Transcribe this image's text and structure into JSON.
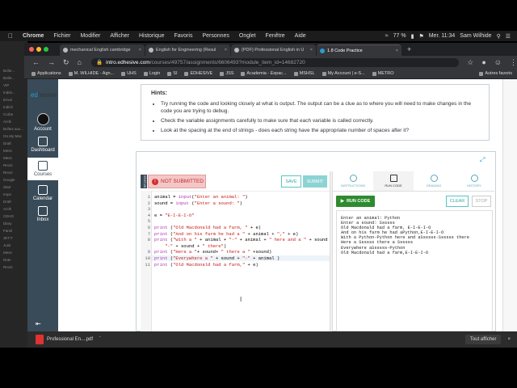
{
  "menubar": {
    "apple": "",
    "items": [
      "Chrome",
      "Fichier",
      "Modifier",
      "Afficher",
      "Historique",
      "Favoris",
      "Personnes",
      "Onglet",
      "Fenêtre",
      "Aide"
    ],
    "battery": "77 %",
    "clock": "Mer. 11:34",
    "user": "Sam Wilhide"
  },
  "tabs": [
    {
      "label": "mechanical English cambridge"
    },
    {
      "label": "English for Engineering (Resul"
    },
    {
      "label": "(PDF) Professional English in U"
    },
    {
      "label": "1.8 Code Practice"
    }
  ],
  "address": {
    "host": "intro.edhesive.com",
    "path": "/courses/49757/assignments/6606493?module_item_id=14682720"
  },
  "bookmarks": [
    "Applications",
    "M. WILHIDE - Agn...",
    "UHS",
    "Login",
    "SI",
    "EDHESIVE",
    "JSS",
    "Academia - Espac...",
    "MSHSL",
    "My Account | e-S...",
    "METRO"
  ],
  "bookmarks_right": "Autres favoris",
  "left_dark_items": [
    "Boîte...",
    "Boîte...",
    "VIP",
    "Indés...",
    "Envoi",
    "Indicé",
    "Corbe",
    "Archi",
    "Boîtes aux...",
    "On My Mac",
    "Draft",
    "Mess",
    "Mess",
    "Recei",
    "Recei",
    "Google",
    "Starr",
    "Impo",
    "Draft",
    "Archi",
    "CEHO",
    "Diary",
    "Famil",
    "JET F",
    "Junk",
    "Mess",
    "Note",
    "Recei"
  ],
  "logo": {
    "a": "ed",
    "b": "hesive"
  },
  "lmenu": [
    {
      "label": "Account",
      "name": "account"
    },
    {
      "label": "Dashboard",
      "name": "dashboard"
    },
    {
      "label": "Courses",
      "name": "courses"
    },
    {
      "label": "Calendar",
      "name": "calendar"
    },
    {
      "label": "Inbox",
      "name": "inbox"
    }
  ],
  "hints": {
    "title": "Hints:",
    "items": [
      "Try running the code and looking closely at what is output.  The output can be a clue as to where you will need to make changes in the code you are trying to debug.",
      "Check the variable assignments carefully to make sure that each variable is called correctly.",
      "Look at the spacing at the end of strings - does each string have the appropriate number of spaces after it?"
    ]
  },
  "ide": {
    "status_side": "STATUS",
    "status": "NOT SUBMITTED",
    "save": "SAVE",
    "submit": "SUBMIT",
    "tabs": [
      "INSTRUCTIONS",
      "RUN CODE",
      "GRADING",
      "HISTORY"
    ],
    "run": "RUN CODE",
    "clear": "CLEAR",
    "stop": "STOP",
    "code_lines": [
      "animal = input(\"Enter an animal: \")",
      "sound = input (\"Enter a sound: \")",
      "",
      "e = \"E-I-E-I-O\"",
      "",
      "print (\"Old Macdonald had a farm, \" + e)",
      "print (\"And on his farm he had a \" + animal + \",\" + e)",
      "print (\"With a \" + animal + \"-\" + animal + \" here and a \" + sound +",
      "    \"-\" + sound + \" there\")",
      "print (\"Here a \"+ sound+ \" there a \" +sound)",
      "print (\"Everywhere a \" + sound + \"-\" + animal )",
      "print (\"Old Macdonald had a farm,\" + e)"
    ],
    "line_numbers": [
      "1",
      "2",
      "3",
      "4",
      "5",
      "6",
      "7",
      "8",
      "",
      "9",
      "10",
      "11"
    ],
    "console": "Enter an animal: Python\nEnter a sound: Ssssss\nOld Macdonald had a farm, E-I-E-I-O\nAnd on his farm he had aPython,E-I-E-I-O\nWith a Python-Python here and aSsssss-Ssssss there\nHere a Ssssss there a Ssssss\nEverywhere aSsssss-Python\nOld Macdonald had a farm,E-I-E-I-O"
  },
  "download": {
    "file": "Professional En....pdf",
    "show_all": "Tout afficher"
  },
  "colors": {
    "sidebar": "#394b58",
    "accent": "#2b9bd6",
    "run": "#2e8b2e",
    "not_submitted": "#c62828"
  }
}
